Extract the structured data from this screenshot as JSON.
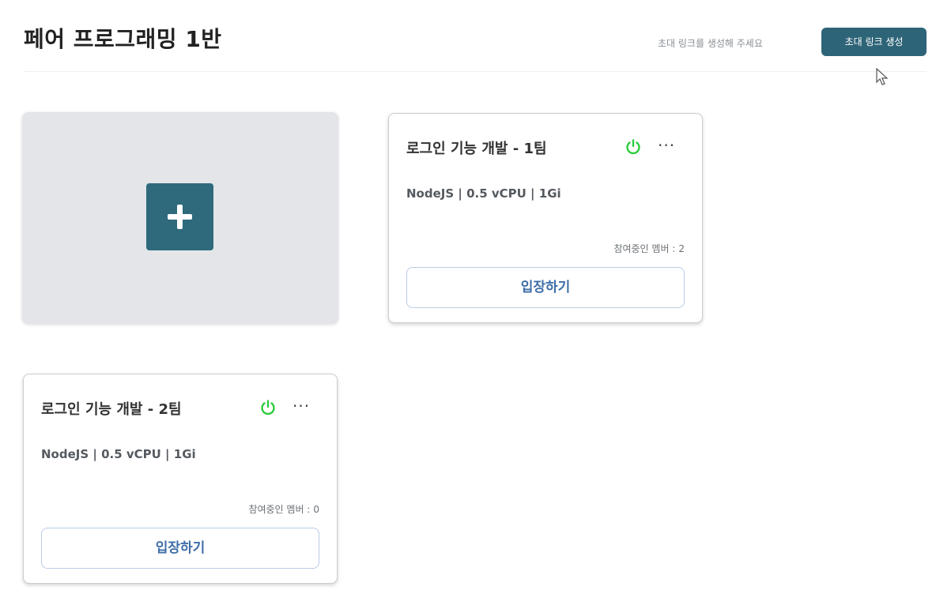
{
  "header": {
    "title": "페어 프로그래밍 1반",
    "hint": "초대 링크를 생성해 주세요",
    "invite_label": "초대 링크 생성"
  },
  "rooms": [
    {
      "title": "로그인 기능 개발 - 1팀",
      "specs": "NodeJS | 0.5 vCPU | 1Gi",
      "members_label": "참여중인 멤버 :",
      "members_count": "2",
      "enter_label": "입장하기",
      "status_icon": "power-icon",
      "status_color": "#2ecc40"
    },
    {
      "title": "로그인 기능 개발 - 2팀",
      "specs": "NodeJS | 0.5 vCPU | 1Gi",
      "members_label": "참여중인 멤버 :",
      "members_count": "0",
      "enter_label": "입장하기",
      "status_icon": "power-icon",
      "status_color": "#2ecc40"
    }
  ],
  "colors": {
    "accent": "#2e6477",
    "add_tile_bg": "#e3e5e9",
    "enter_text": "#3e6ea8"
  }
}
